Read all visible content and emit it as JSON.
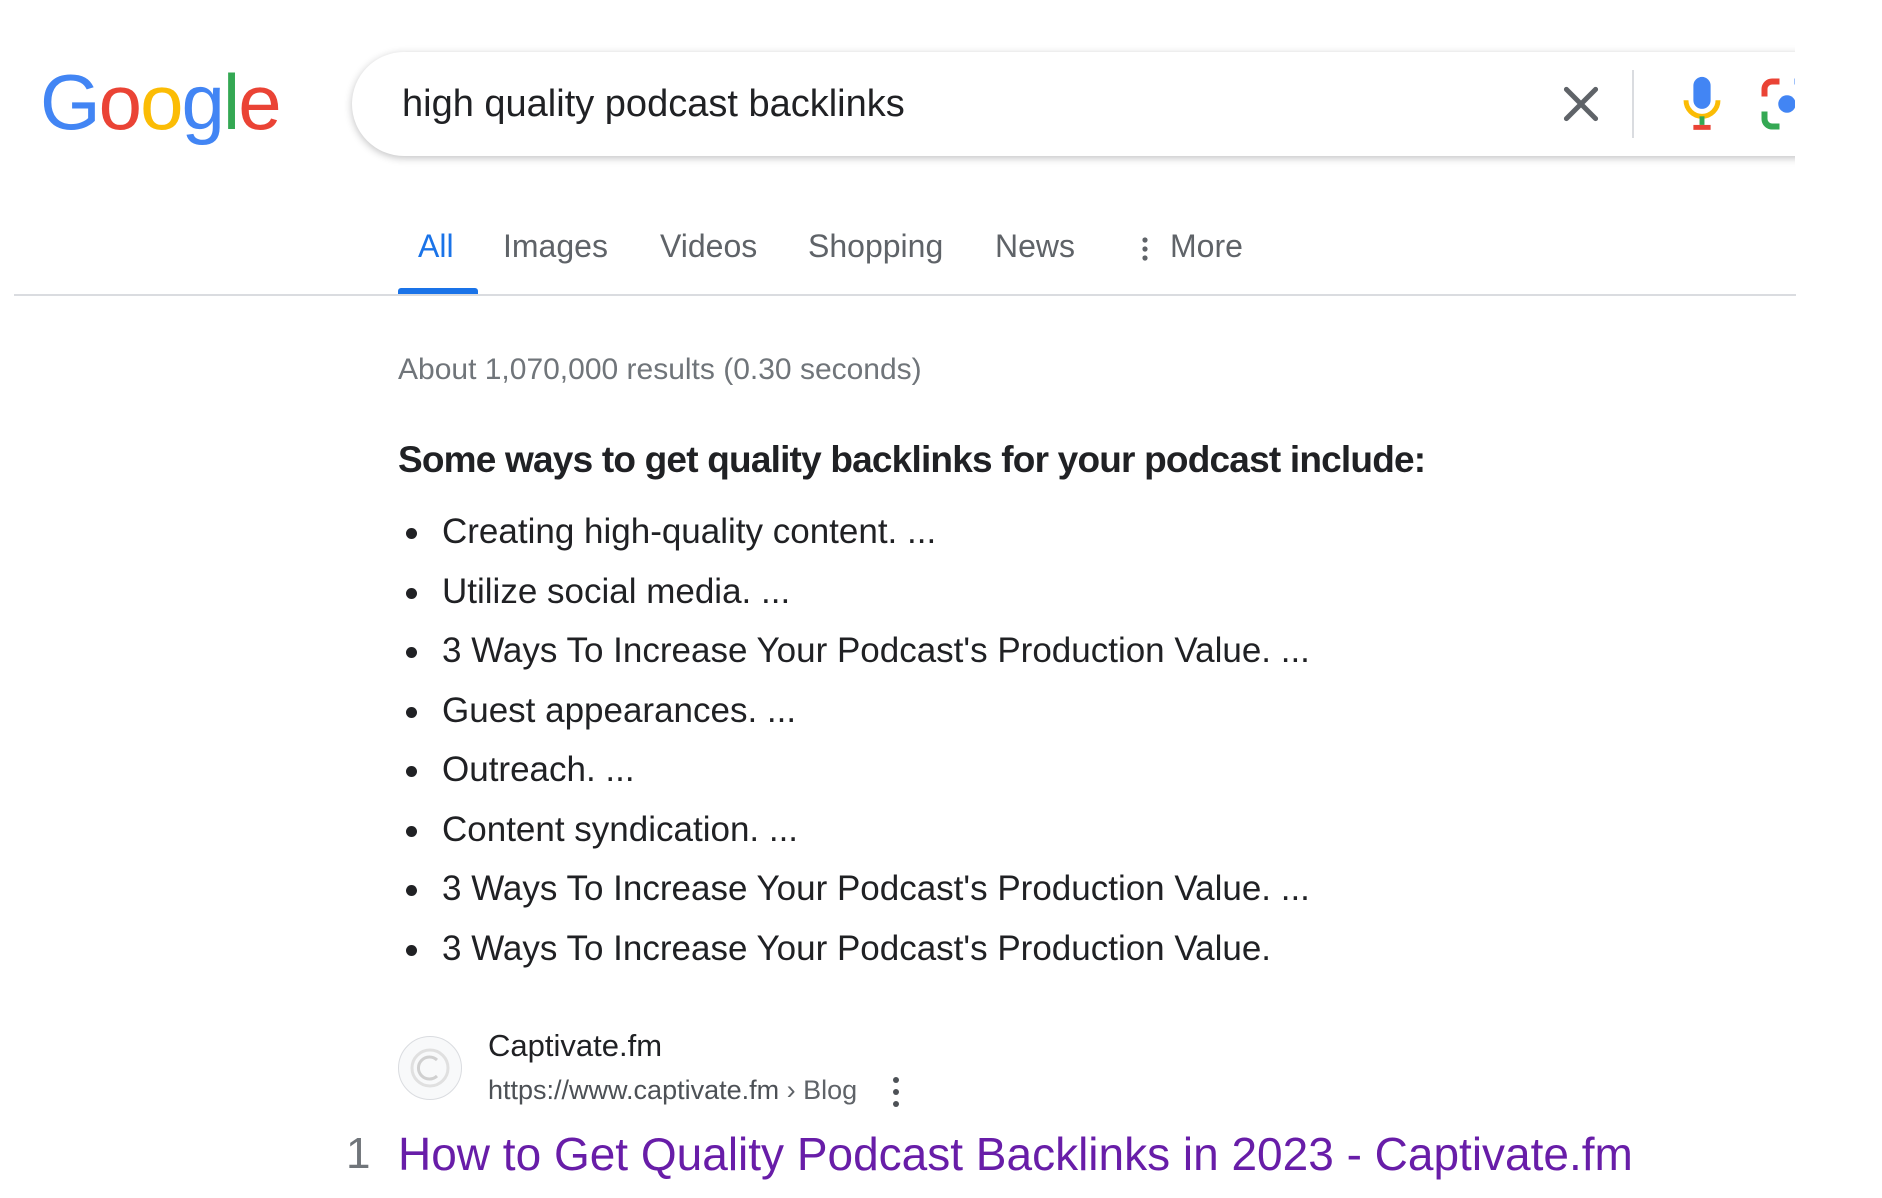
{
  "logo": {
    "letters": [
      {
        "char": "G",
        "color": "#4285F4"
      },
      {
        "char": "o",
        "color": "#EA4335"
      },
      {
        "char": "o",
        "color": "#FBBC05"
      },
      {
        "char": "g",
        "color": "#4285F4"
      },
      {
        "char": "l",
        "color": "#34A853"
      },
      {
        "char": "e",
        "color": "#EA4335"
      }
    ]
  },
  "search": {
    "query": "high quality podcast backlinks"
  },
  "icons": {
    "clear": "close-icon",
    "voice": "microphone-icon",
    "lens": "camera-lens-icon",
    "more": "vertical-dots-icon"
  },
  "tabs": [
    {
      "label": "All",
      "active": true
    },
    {
      "label": "Images",
      "active": false
    },
    {
      "label": "Videos",
      "active": false
    },
    {
      "label": "Shopping",
      "active": false
    },
    {
      "label": "News",
      "active": false
    },
    {
      "label": "More",
      "active": false
    }
  ],
  "results": {
    "stats": "About 1,070,000 results (0.30 seconds)"
  },
  "snippet": {
    "heading": "Some ways to get quality backlinks for your podcast include:",
    "items": [
      "Creating high-quality content. ...",
      "Utilize social media. ...",
      "3 Ways To Increase Your Podcast's Production Value. ...",
      "Guest appearances. ...",
      "Outreach. ...",
      "Content syndication. ...",
      "3 Ways To Increase Your Podcast's Production Value. ...",
      "3 Ways To Increase Your Podcast's Production Value."
    ]
  },
  "first_result": {
    "site_name": "Captivate.fm",
    "url": "https://www.captivate.fm",
    "breadcrumb": " › Blog",
    "number": "1",
    "title": "How to Get Quality Podcast Backlinks in 2023 - Captivate.fm"
  },
  "colors": {
    "link_visited": "#681da8",
    "accent": "#1a73e8"
  }
}
